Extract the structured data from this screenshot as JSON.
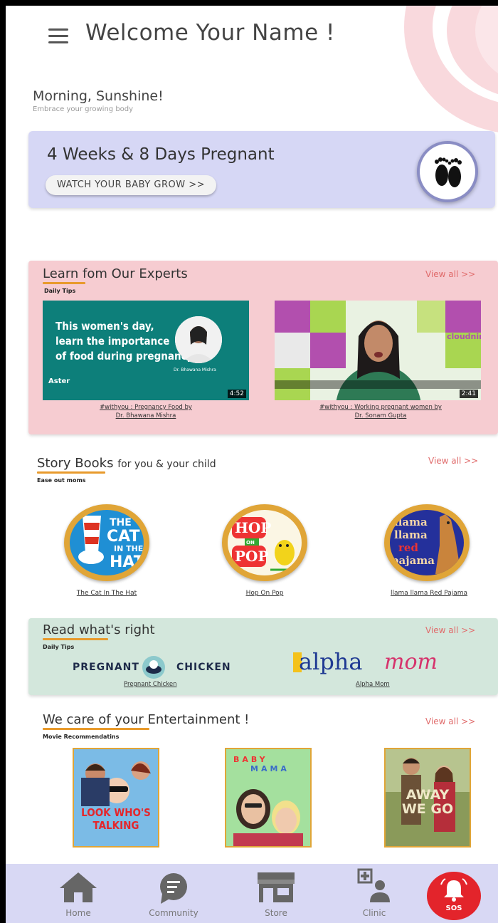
{
  "header": {
    "title": "Welcome Your Name !",
    "greeting": "Morning, Sunshine!",
    "sub_greeting": "Embrace your growing body"
  },
  "pregnancy": {
    "title": "4 Weeks & 8 Days Pregnant",
    "button": "WATCH YOUR BABY GROW >>",
    "icon": "baby-feet-icon"
  },
  "experts": {
    "title": "Learn fom Our Experts",
    "subtitle": "Daily Tips",
    "view_all": "View all >>",
    "videos": [
      {
        "overlay_lines": [
          "This women's day,",
          "learn the importance",
          "of food during pregnancy"
        ],
        "doctor_tag": "Dr. Bhawana Mishra",
        "brand": "Aster",
        "duration": "4:52",
        "caption_1": "#withyou : Pregnancy Food by",
        "caption_2": "Dr. Bhawana Mishra"
      },
      {
        "brand": "cloudnine",
        "duration": "2:41",
        "caption_1": "#withyou : Working pregnant women by",
        "caption_2": "Dr. Sonam Gupta"
      }
    ]
  },
  "books": {
    "title": "Story Books",
    "title_small": "for you & your child",
    "subtitle": "Ease out moms",
    "view_all": "View all >>",
    "items": [
      {
        "cover_text": "THE CAT IN THE HAT",
        "caption": "The Cat In The Hat"
      },
      {
        "cover_text": "HOP ON POP",
        "caption": "Hop On Pop"
      },
      {
        "cover_text": "llama llama red pajama",
        "caption": "llama llama Red Pajama"
      }
    ]
  },
  "read": {
    "title": "Read what's right",
    "subtitle": "Daily Tips",
    "view_all": "View all >>",
    "brands": [
      {
        "left_word": "PREGNANT",
        "right_word": "CHICKEN",
        "caption": "Pregnant Chicken"
      },
      {
        "word1": "alpha",
        "word2": "mom",
        "caption": "Alpha Mom"
      }
    ]
  },
  "entertainment": {
    "title": "We care of your Entertainment !",
    "subtitle": "Movie Recommendatins",
    "view_all": "View all >>",
    "posters": [
      {
        "text_1": "LOOK WHO'S",
        "text_2": "TALKING"
      },
      {
        "text_1": "BABY",
        "text_2": "MAMA"
      },
      {
        "text_1": "AWAY",
        "text_2": "WE GO"
      }
    ]
  },
  "nav": {
    "items": [
      {
        "label": "Home",
        "icon": "home-icon"
      },
      {
        "label": "Community",
        "icon": "chat-icon"
      },
      {
        "label": "Store",
        "icon": "store-icon"
      },
      {
        "label": "Clinic",
        "icon": "clinic-icon"
      }
    ],
    "sos": "SOS"
  },
  "colors": {
    "accent_orange": "#e89a2c",
    "view_all_red": "#e06b6b",
    "sos_red": "#e3242b",
    "nav_bg": "#d8d8f4"
  }
}
